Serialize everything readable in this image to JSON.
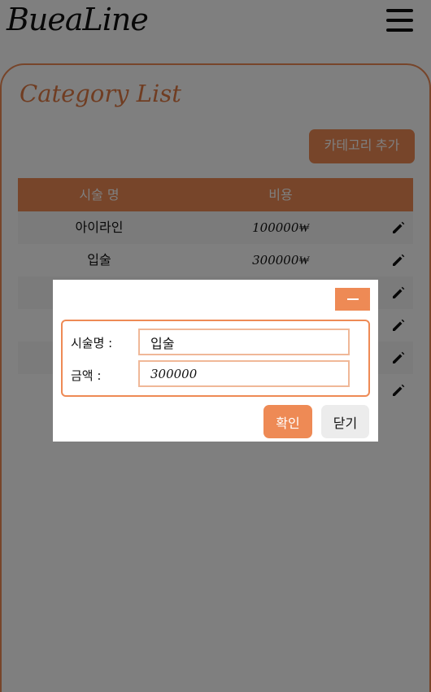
{
  "app": {
    "logo": "BueaLine"
  },
  "card": {
    "title": "Category List",
    "add_button": "카테고리 추가"
  },
  "table": {
    "headers": [
      "시술 명",
      "비용"
    ],
    "rows": [
      {
        "name": "아이라인",
        "price": "100000₩"
      },
      {
        "name": "입술",
        "price": "300000₩"
      },
      {
        "name": "",
        "price": ""
      },
      {
        "name": "",
        "price": ""
      },
      {
        "name": "",
        "price": ""
      },
      {
        "name": "",
        "price": ""
      }
    ]
  },
  "modal": {
    "name_label": "시술명 :",
    "name_value": "입술",
    "price_label": "금액 :",
    "price_value": "300000",
    "confirm_button": "확인",
    "close_button": "닫기"
  },
  "icons": {
    "menu": "hamburger-menu-icon",
    "edit": "pencil-icon",
    "minimize": "minus-icon"
  },
  "colors": {
    "accent": "#ee8a55",
    "overlay": "rgba(0,0,0,0.5)"
  }
}
